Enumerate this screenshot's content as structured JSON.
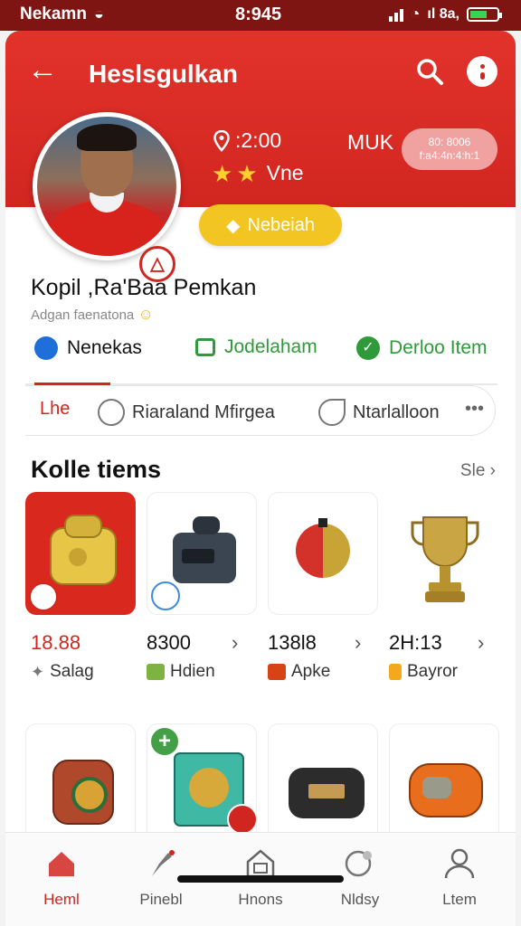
{
  "status_bar": {
    "carrier": "Nekamn",
    "time": "8:945",
    "signal_text": "ıl 8a,"
  },
  "header": {
    "title": "Heslsgulkan",
    "location_value": ":2:00",
    "rating_text": "Vne",
    "muk_label": "MUK",
    "badge_line1": "80: 8006",
    "badge_line2": "f:a4:4n:4:h:1"
  },
  "follow_button": {
    "label": "Nebeiah"
  },
  "profile": {
    "name": "Kopil ,Ra'Baa Pemkan",
    "subtitle": "Adgan faenatona"
  },
  "tabs": [
    {
      "label": "Nenekas",
      "color": "#1e6fd9"
    },
    {
      "label": "Jodelaham",
      "color": "#2e9a3a"
    },
    {
      "label": "Derloo Item",
      "color": "#2e9a3a"
    }
  ],
  "chips": [
    {
      "label": "Lhe"
    },
    {
      "label": "Riaraland Mfirgea"
    },
    {
      "label": "Ntarlalloon"
    }
  ],
  "section": {
    "title": "Kolle tiems",
    "see_all": "Sle"
  },
  "items": [
    {
      "price": "18.88",
      "tag": "Salag"
    },
    {
      "price": "8300",
      "tag": "Hdien"
    },
    {
      "price": "138l8",
      "tag": "Apke"
    },
    {
      "price": "2H:13",
      "tag": "Bayror"
    }
  ],
  "bottom_nav": [
    {
      "label": "Heml"
    },
    {
      "label": "Pinebl"
    },
    {
      "label": "Hnons"
    },
    {
      "label": "Nldsy"
    },
    {
      "label": "Ltem"
    }
  ],
  "colors": {
    "brand_red": "#d12620",
    "accent_yellow": "#f2c523"
  }
}
